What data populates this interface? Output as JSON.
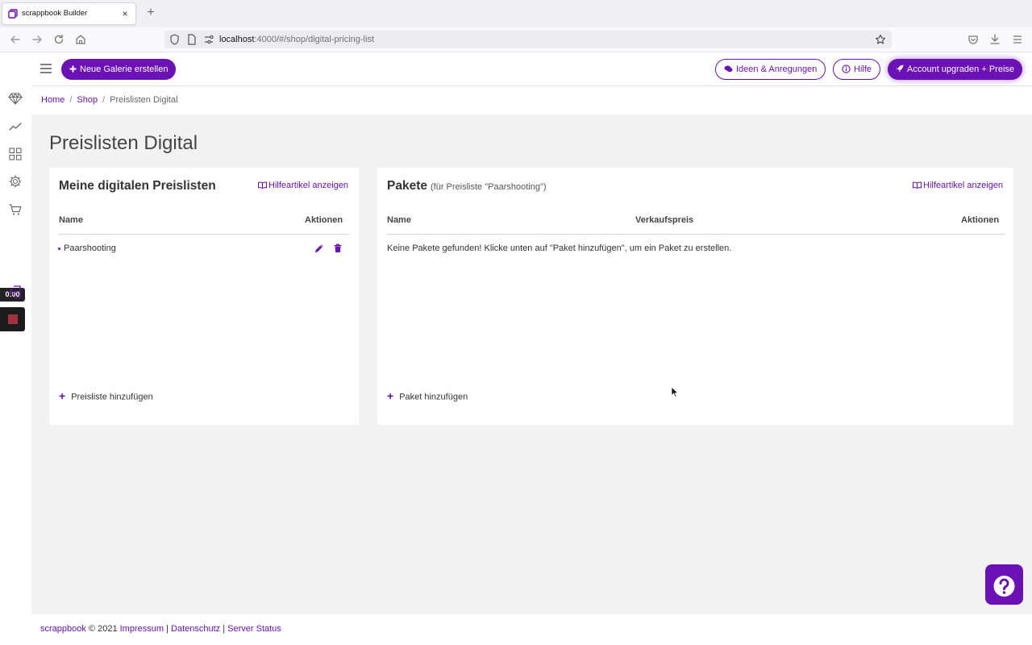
{
  "browser": {
    "tab_title": "scrappbook Builder",
    "tab_close": "×",
    "new_tab": "+",
    "url_host": "localhost",
    "url_path": ":4000/#/shop/digital-pricing-list"
  },
  "header": {
    "new_gallery_label": "Neue Galerie erstellen",
    "ideas_label": "Ideen & Anregungen",
    "help_label": "Hilfe",
    "upgrade_label": "Account upgraden + Preise"
  },
  "recorder": {
    "timer": "0:00"
  },
  "breadcrumb": {
    "home": "Home",
    "shop": "Shop",
    "current": "Preislisten Digital",
    "separator": "/"
  },
  "page": {
    "title": "Preislisten Digital"
  },
  "price_lists": {
    "title": "Meine digitalen Preislisten",
    "help_link": "Hilfeartikel anzeigen",
    "columns": [
      "Name",
      "Aktionen"
    ],
    "rows": [
      {
        "name": "Paarshooting"
      }
    ],
    "add_label": "Preisliste hinzufügen"
  },
  "packages": {
    "title": "Pakete",
    "subtitle": "(für Preisliste \"Paarshooting\")",
    "help_link": "Hilfeartikel anzeigen",
    "columns": [
      "Name",
      "Verkaufspreis",
      "Aktionen"
    ],
    "empty_message": "Keine Pakete gefunden! Klicke unten auf \"Paket hinzufügen\", um ein Paket zu erstellen.",
    "add_label": "Paket hinzufügen"
  },
  "footer": {
    "brand": "scrappbook",
    "copyright": " © 2021 ",
    "impressum": "Impressum",
    "sep": " | ",
    "datenschutz": "Datenschutz",
    "server_status": "Server Status"
  },
  "colors": {
    "accent": "#6b11b6",
    "background": "#f2f2f2"
  }
}
